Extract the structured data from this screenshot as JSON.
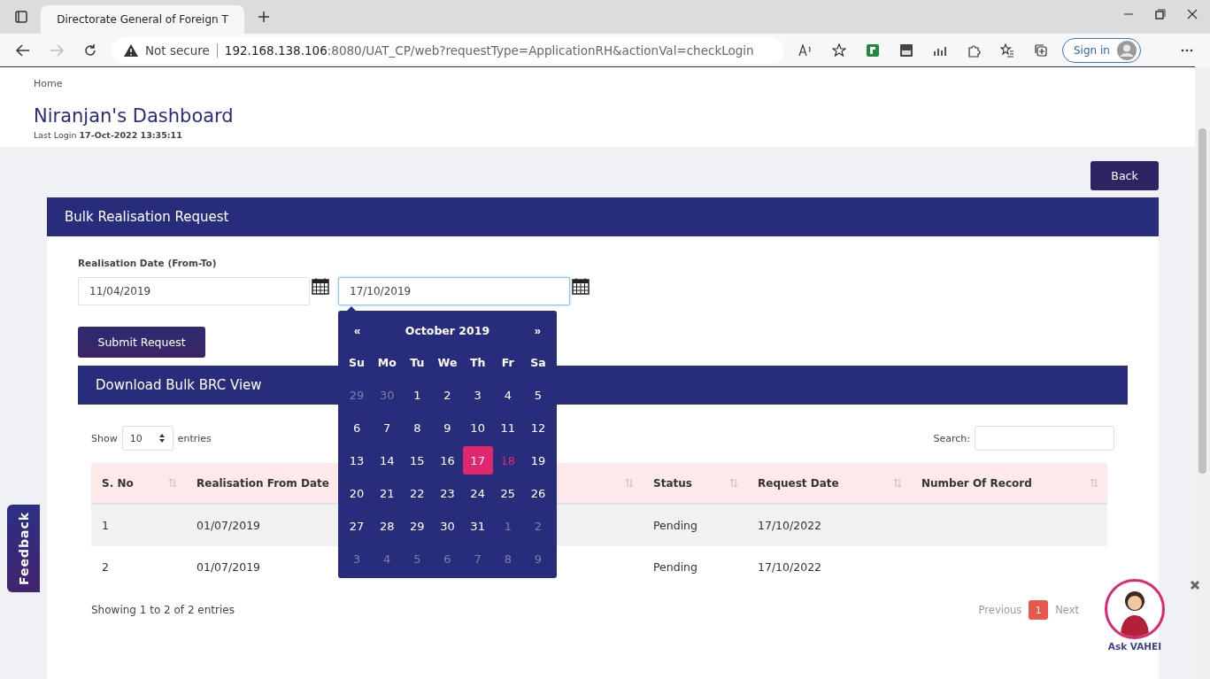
{
  "browser": {
    "tab_title": "Directorate General of Foreign T",
    "security": "Not secure",
    "url_host": "192.168.138.106",
    "url_rest": ":8080/UAT_CP/web?requestType=ApplicationRH&actionVal=checkLogin",
    "sign_in": "Sign in"
  },
  "breadcrumb": "Home",
  "title": "Niranjan's Dashboard",
  "last_login": {
    "label": "Last Login",
    "value": "17-Oct-2022 13:35:11"
  },
  "back_button": "Back",
  "card_title": "Bulk Realisation Request",
  "date_label": "Realisation Date (From-To)",
  "date_from": "11/04/2019",
  "date_to": "17/10/2019",
  "submit_button": "Submit Request",
  "calendar": {
    "prev": "«",
    "month": "October 2019",
    "next": "»",
    "weekdays": [
      "Su",
      "Mo",
      "Tu",
      "We",
      "Th",
      "Fr",
      "Sa"
    ],
    "days": [
      {
        "label": "29",
        "kind": "muted",
        "selected": false
      },
      {
        "label": "30",
        "kind": "muted",
        "selected": false
      },
      {
        "label": "1",
        "kind": "normal",
        "selected": false
      },
      {
        "label": "2",
        "kind": "normal",
        "selected": false
      },
      {
        "label": "3",
        "kind": "normal",
        "selected": false
      },
      {
        "label": "4",
        "kind": "normal",
        "selected": false
      },
      {
        "label": "5",
        "kind": "normal",
        "selected": false
      },
      {
        "label": "6",
        "kind": "normal",
        "selected": false
      },
      {
        "label": "7",
        "kind": "normal",
        "selected": false
      },
      {
        "label": "8",
        "kind": "normal",
        "selected": false
      },
      {
        "label": "9",
        "kind": "normal",
        "selected": false
      },
      {
        "label": "10",
        "kind": "normal",
        "selected": false
      },
      {
        "label": "11",
        "kind": "normal",
        "selected": false
      },
      {
        "label": "12",
        "kind": "normal",
        "selected": false
      },
      {
        "label": "13",
        "kind": "normal",
        "selected": false
      },
      {
        "label": "14",
        "kind": "normal",
        "selected": false
      },
      {
        "label": "15",
        "kind": "normal",
        "selected": false
      },
      {
        "label": "16",
        "kind": "normal",
        "selected": false
      },
      {
        "label": "17",
        "kind": "normal",
        "selected": true
      },
      {
        "label": "18",
        "kind": "today",
        "selected": false
      },
      {
        "label": "19",
        "kind": "normal",
        "selected": false
      },
      {
        "label": "20",
        "kind": "normal",
        "selected": false
      },
      {
        "label": "21",
        "kind": "normal",
        "selected": false
      },
      {
        "label": "22",
        "kind": "normal",
        "selected": false
      },
      {
        "label": "23",
        "kind": "normal",
        "selected": false
      },
      {
        "label": "24",
        "kind": "normal",
        "selected": false
      },
      {
        "label": "25",
        "kind": "normal",
        "selected": false
      },
      {
        "label": "26",
        "kind": "normal",
        "selected": false
      },
      {
        "label": "27",
        "kind": "normal",
        "selected": false
      },
      {
        "label": "28",
        "kind": "normal",
        "selected": false
      },
      {
        "label": "29",
        "kind": "normal",
        "selected": false
      },
      {
        "label": "30",
        "kind": "normal",
        "selected": false
      },
      {
        "label": "31",
        "kind": "normal",
        "selected": false
      },
      {
        "label": "1",
        "kind": "muted",
        "selected": false
      },
      {
        "label": "2",
        "kind": "muted",
        "selected": false
      },
      {
        "label": "3",
        "kind": "muted",
        "selected": false
      },
      {
        "label": "4",
        "kind": "muted",
        "selected": false
      },
      {
        "label": "5",
        "kind": "muted",
        "selected": false
      },
      {
        "label": "6",
        "kind": "muted",
        "selected": false
      },
      {
        "label": "7",
        "kind": "muted",
        "selected": false
      },
      {
        "label": "8",
        "kind": "muted",
        "selected": false
      },
      {
        "label": "9",
        "kind": "muted",
        "selected": false
      }
    ]
  },
  "section_title": "Download Bulk BRC View",
  "length": {
    "show": "Show",
    "value": "10",
    "entries": "entries"
  },
  "search_label": "Search:",
  "table": {
    "columns": [
      {
        "label": "S. No"
      },
      {
        "label": "Realisation From Date"
      },
      {
        "label": "Status"
      },
      {
        "label": "Request Date"
      },
      {
        "label": "Number Of Record"
      }
    ],
    "rows": [
      {
        "cells": [
          "1",
          "01/07/2019",
          "Pending",
          "17/10/2022"
        ]
      },
      {
        "cells": [
          "2",
          "01/07/2019",
          "Pending",
          "17/10/2022"
        ]
      }
    ]
  },
  "info": "Showing 1 to 2 of 2 entries",
  "pagination": {
    "previous": "Previous",
    "pages": [
      {
        "label": "1",
        "selected": true
      }
    ],
    "next": "Next"
  },
  "feedback": "Feedback",
  "assistant": "Ask VAHEI"
}
